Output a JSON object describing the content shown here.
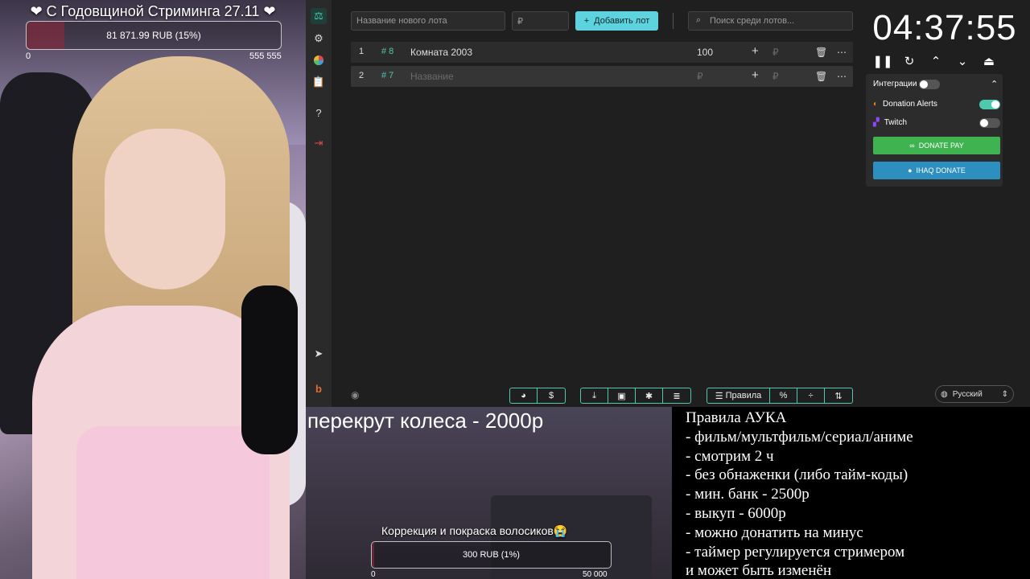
{
  "overlay_top": {
    "title": "❤  С Годовщиной Стриминга 27.11 ❤",
    "progress_text": "81 871.99 RUB (15%)",
    "progress_fraction": 0.15,
    "min": "0",
    "max": "555 555"
  },
  "toolbar_top": {
    "new_lot_placeholder": "Название нового лота",
    "amount_placeholder": "₽",
    "add_lot_label": "Добавить лот",
    "search_placeholder": "Поиск среди лотов..."
  },
  "lots": [
    {
      "index": "1",
      "id": "# 8",
      "name": "Комната 2003",
      "amount": "100",
      "currency": "₽"
    },
    {
      "index": "2",
      "id": "# 7",
      "name": "Название",
      "amount": "₽",
      "currency": "₽"
    }
  ],
  "timer": "04:37:55",
  "integrations": {
    "title": "Интеграции",
    "donation_alerts": "Donation Alerts",
    "twitch": "Twitch",
    "donate_pay": "DONATE PAY",
    "ihaq_donate": "IHAQ DONATE",
    "colors": {
      "accent": "#4ec9b0",
      "donatepay": "#3fb34f",
      "ihaq": "#2c8fbf"
    }
  },
  "bottom_toolbar": {
    "rules_label": "Правила",
    "percent_label": "%"
  },
  "language": "Русский",
  "reroll_text": "перекрут колеса - 2000р",
  "goal": {
    "title": "Коррекция и покраска волосиков😭",
    "progress_text": "300 RUB (1%)",
    "progress_fraction": 0.01,
    "min": "0",
    "max": "50 000"
  },
  "rules": {
    "lines": [
      "Правила АУКА",
      "- фильм/мультфильм/сериал/аниме",
      "- смотрим 2 ч",
      "- без обнаженки (либо тайм-коды)",
      "- мин. банк - 2500р",
      "- выкуп - 6000р",
      "- можно донатить на минус",
      "- таймер регулируется стримером",
      "и может быть изменён"
    ]
  }
}
